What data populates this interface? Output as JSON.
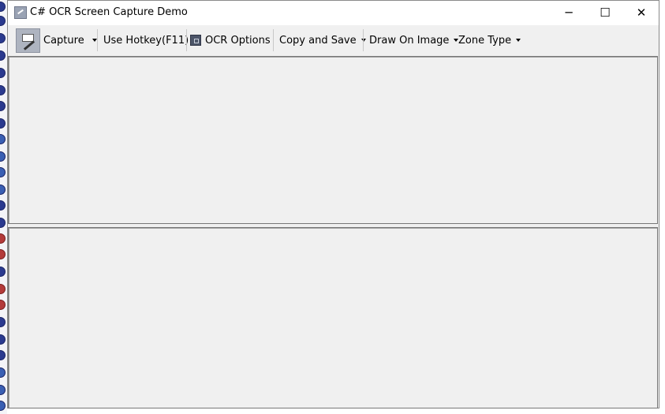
{
  "window": {
    "title": "C# OCR Screen Capture Demo",
    "controls": {
      "minimize": "─",
      "maximize": "☐",
      "close": "✕"
    }
  },
  "toolbar": {
    "capture": "Capture",
    "hotkey": "Use Hotkey(F11)",
    "ocr_options": "OCR Options",
    "copy_save": "Copy and Save",
    "draw_on_image": "Draw On Image",
    "zone_type": "Zone Type"
  },
  "icons": {
    "app": "app-icon",
    "capture": "capture-icon",
    "ocr_options": "ocr-options-icon"
  },
  "colors": {
    "window_bg": "#f0f0f0",
    "titlebar_bg": "#ffffff",
    "panel_border": "#777777"
  }
}
